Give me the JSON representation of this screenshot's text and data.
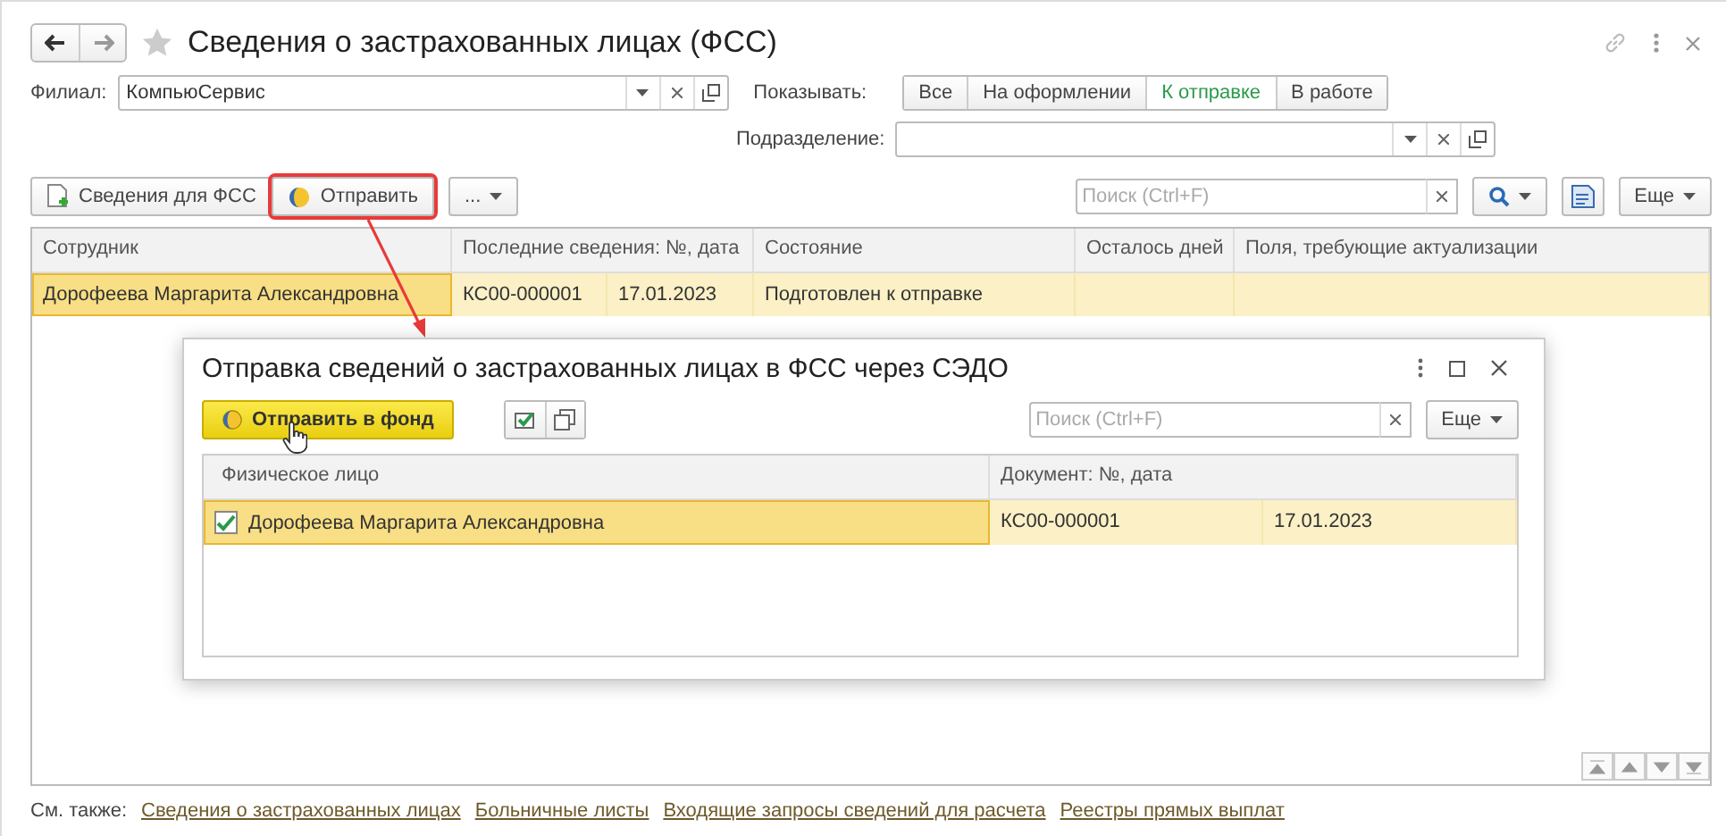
{
  "window": {
    "title": "Сведения о застрахованных лицах (ФСС)"
  },
  "filters": {
    "branch_label": "Филиал:",
    "branch_value": "КомпьюСервис",
    "show_label": "Показывать:",
    "department_label": "Подразделение:",
    "show_options": [
      {
        "label": "Все",
        "selected": false
      },
      {
        "label": "На оформлении",
        "selected": false
      },
      {
        "label": "К отправке",
        "selected": true
      },
      {
        "label": "В работе",
        "selected": false
      }
    ]
  },
  "toolbar": {
    "buttons": [
      {
        "label": "Сведения для ФСС",
        "highlighted": false
      },
      {
        "label": "Отправить",
        "highlighted": true
      }
    ],
    "more_menu": "...",
    "search": {
      "placeholder": "Поиск (Ctrl+F)"
    },
    "more": "Еще"
  },
  "table": {
    "columns": [
      "Сотрудник",
      "Последние сведения: №, дата",
      "Состояние",
      "Осталось дней",
      "Поля, требующие актуализации"
    ],
    "rows": [
      {
        "employee": "Дорофеева Маргарита Александровна",
        "number": "КС00-000001",
        "date": "17.01.2023",
        "status": "Подготовлен к отправке",
        "selected": true
      }
    ]
  },
  "dialog": {
    "title": "Отправка сведений о застрахованных лицах в ФСС через СЭДО",
    "send_button": "Отправить в фонд",
    "search": {
      "placeholder": "Поиск (Ctrl+F)"
    },
    "more": "Еще",
    "columns": [
      "Физическое лицо",
      "Документ: №, дата"
    ],
    "rows": [
      {
        "checked": true,
        "person": "Дорофеева Маргарита Александровна",
        "number": "КС00-000001",
        "date": "17.01.2023",
        "selected": true
      }
    ]
  },
  "footer": {
    "label": "См. также:",
    "links": [
      "Сведения о застрахованных лицах",
      "Больничные листы",
      "Входящие запросы сведений для расчета",
      "Реестры прямых выплат"
    ]
  }
}
